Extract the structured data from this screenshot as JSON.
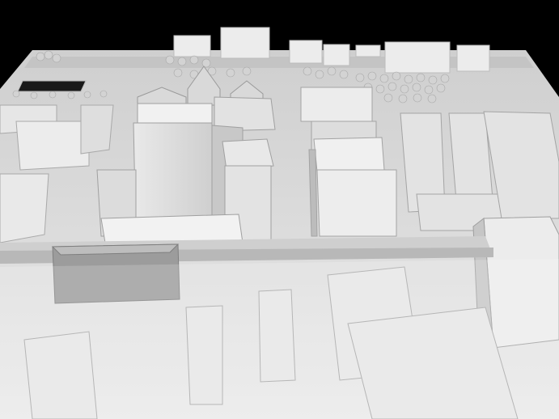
{
  "image": {
    "subject": "architectural-massing-model",
    "palette": {
      "background": "#000000",
      "base": "#dcdcdc",
      "street": "#c9c9c9",
      "building_light": "#f2f2f2",
      "building_mid": "#d6d6d6",
      "building_shadow": "#a9a9a9",
      "tree": "#cfcfcf",
      "dark_plate": "#1a1a1a"
    }
  }
}
